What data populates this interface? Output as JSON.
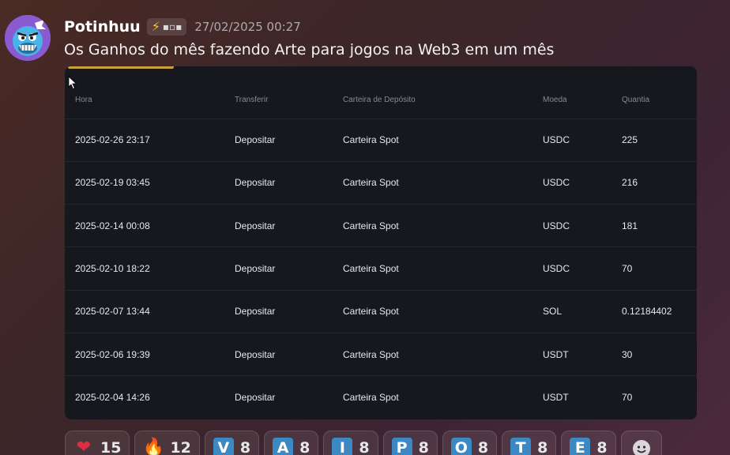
{
  "message": {
    "username": "Potinhuu",
    "tag_text": "▪▫▪",
    "timestamp": "27/02/2025 00:27",
    "text": "Os Ganhos do mês fazendo Arte para jogos na Web3 em um mês"
  },
  "table": {
    "headers": [
      "Hora",
      "Transferir",
      "Carteira de Depósito",
      "Moeda",
      "Quantia"
    ],
    "rows": [
      [
        "2025-02-26 23:17",
        "Depositar",
        "Carteira Spot",
        "USDC",
        "225"
      ],
      [
        "2025-02-19 03:45",
        "Depositar",
        "Carteira Spot",
        "USDC",
        "216"
      ],
      [
        "2025-02-14 00:08",
        "Depositar",
        "Carteira Spot",
        "USDC",
        "181"
      ],
      [
        "2025-02-10 18:22",
        "Depositar",
        "Carteira Spot",
        "USDC",
        "70"
      ],
      [
        "2025-02-07 13:44",
        "Depositar",
        "Carteira Spot",
        "SOL",
        "0.12184402"
      ],
      [
        "2025-02-06 19:39",
        "Depositar",
        "Carteira Spot",
        "USDT",
        "30"
      ],
      [
        "2025-02-04 14:26",
        "Depositar",
        "Carteira Spot",
        "USDT",
        "70"
      ]
    ]
  },
  "reactions": [
    {
      "icon": "heart-icon",
      "glyph": "❤",
      "count": "15"
    },
    {
      "icon": "fire-icon",
      "glyph": "🔥",
      "count": "12"
    },
    {
      "icon": "letter-v-icon",
      "letter": "V",
      "count": "8"
    },
    {
      "icon": "letter-a-icon",
      "letter": "A",
      "count": "8"
    },
    {
      "icon": "letter-i-icon",
      "letter": "I",
      "count": "8"
    },
    {
      "icon": "letter-p-icon",
      "letter": "P",
      "count": "8"
    },
    {
      "icon": "letter-o-icon",
      "letter": "O",
      "count": "8"
    },
    {
      "icon": "letter-t-icon",
      "letter": "T",
      "count": "8"
    },
    {
      "icon": "letter-e-icon",
      "letter": "E",
      "count": "8"
    }
  ],
  "colors": {
    "letter_tile": "#3b88c3",
    "heart": "#dd2e44",
    "fire": "#f4900c",
    "tag_bolt": "#f6c343"
  }
}
